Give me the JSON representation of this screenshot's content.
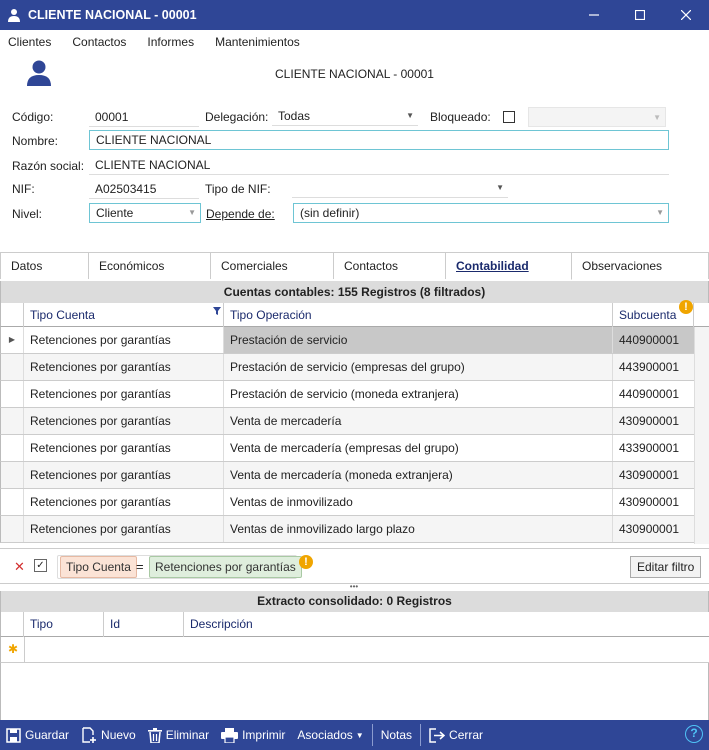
{
  "window": {
    "title": "CLIENTE NACIONAL - 00001"
  },
  "menu": [
    "Clientes",
    "Contactos",
    "Informes",
    "Mantenimientos"
  ],
  "header": {
    "title": "CLIENTE NACIONAL - 00001"
  },
  "form": {
    "codigo_label": "Código:",
    "codigo": "00001",
    "delegacion_label": "Delegación:",
    "delegacion": "Todas",
    "bloqueado_label": "Bloqueado:",
    "nombre_label": "Nombre:",
    "nombre": "CLIENTE NACIONAL",
    "razon_label": "Razón social:",
    "razon": "CLIENTE NACIONAL",
    "nif_label": "NIF:",
    "nif": "A02503415",
    "tiponif_label": "Tipo de NIF:",
    "tiponif": "",
    "nivel_label": "Nivel:",
    "nivel": "Cliente",
    "depende_label": "Depende de:",
    "depende": "(sin definir)"
  },
  "tabs": [
    "Datos",
    "Económicos",
    "Comerciales",
    "Contactos",
    "Contabilidad",
    "Observaciones"
  ],
  "active_tab": "Contabilidad",
  "grid": {
    "title": "Cuentas contables: 155 Registros (8 filtrados)",
    "columns": [
      "Tipo Cuenta",
      "Tipo Operación",
      "Subcuenta"
    ],
    "rows": [
      [
        "Retenciones por garantías",
        "Prestación de servicio",
        "440900001"
      ],
      [
        "Retenciones por garantías",
        "Prestación de servicio (empresas del grupo)",
        "443900001"
      ],
      [
        "Retenciones por garantías",
        "Prestación de servicio (moneda extranjera)",
        "440900001"
      ],
      [
        "Retenciones por garantías",
        "Venta de mercadería",
        "430900001"
      ],
      [
        "Retenciones por garantías",
        "Venta de mercadería (empresas del grupo)",
        "433900001"
      ],
      [
        "Retenciones por garantías",
        "Venta de mercadería (moneda extranjera)",
        "430900001"
      ],
      [
        "Retenciones por garantías",
        "Ventas de inmovilizado",
        "430900001"
      ],
      [
        "Retenciones por garantías",
        "Ventas de inmovilizado largo plazo",
        "430900001"
      ]
    ]
  },
  "filter": {
    "field": "Tipo Cuenta",
    "op": "=",
    "value": "Retenciones por garantías",
    "edit_button": "Editar filtro"
  },
  "subgrid": {
    "title": "Extracto consolidado: 0 Registros",
    "columns": [
      "Tipo",
      "Id",
      "Descripción"
    ]
  },
  "toolbar": {
    "guardar": "Guardar",
    "nuevo": "Nuevo",
    "eliminar": "Eliminar",
    "imprimir": "Imprimir",
    "asociados": "Asociados",
    "notas": "Notas",
    "cerrar": "Cerrar"
  },
  "colors": {
    "titlebar": "#2f4696",
    "accent": "#6ec5d4",
    "warn": "#f0a500"
  }
}
